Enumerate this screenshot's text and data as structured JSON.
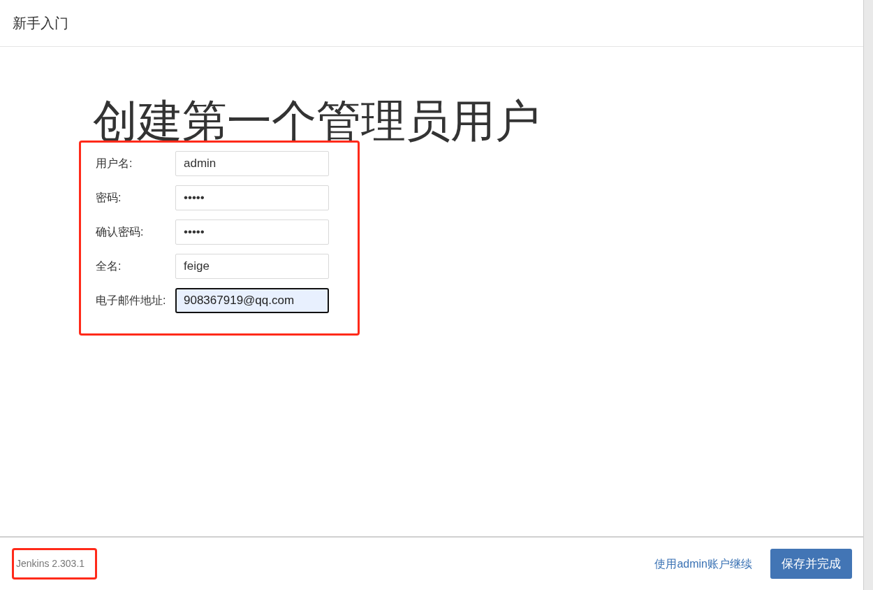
{
  "header": {
    "title": "新手入门"
  },
  "heading": "创建第一个管理员用户",
  "fields": [
    {
      "label": "用户名:",
      "value": "admin",
      "focused": false
    },
    {
      "label": "密码:",
      "value": "•••••",
      "focused": false
    },
    {
      "label": "确认密码:",
      "value": "•••••",
      "focused": false
    },
    {
      "label": "全名:",
      "value": "feige",
      "focused": false
    },
    {
      "label": "电子邮件地址:",
      "value": "908367919@qq.com",
      "focused": true
    }
  ],
  "footer": {
    "version": "Jenkins 2.303.1",
    "link": "使用admin账户继续",
    "button": "保存并完成"
  }
}
